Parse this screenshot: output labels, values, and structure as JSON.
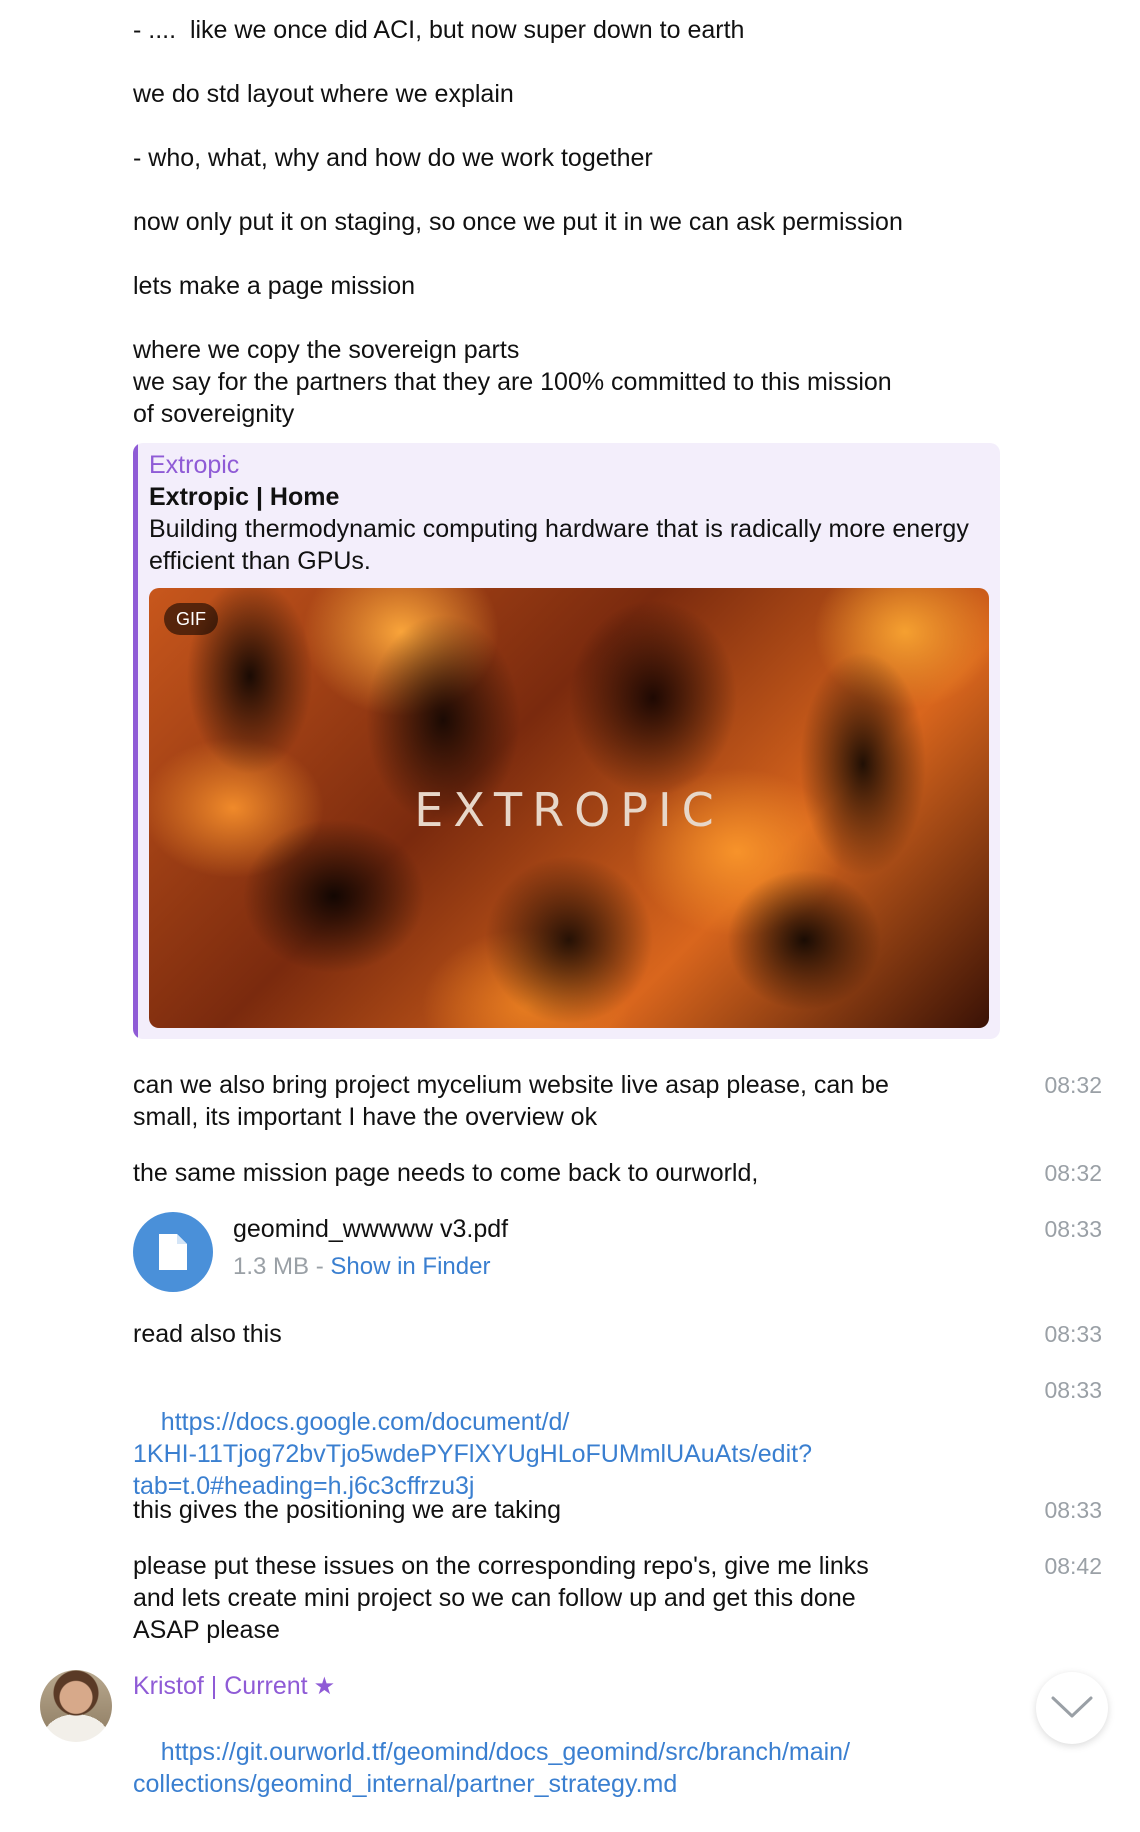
{
  "messages": [
    {
      "text": "- ....  like we once did ACI, but now super down to earth"
    },
    {
      "text": "we do std layout where we explain"
    },
    {
      "text": "- who, what, why and how do we work together"
    },
    {
      "text": "now only put it on staging, so once we put it in we can ask permission"
    },
    {
      "text": "lets make a page mission"
    },
    {
      "text": "where we copy the sovereign parts\nwe say for the partners that they are 100% committed to this mission\nof sovereignity"
    }
  ],
  "link_preview": {
    "site": "Extropic",
    "title": "Extropic | Home",
    "description": "Building thermodynamic computing hardware that is radically more energy efficient than GPUs.",
    "gif_badge": "GIF",
    "gif_logo": "EXTROPIC"
  },
  "timed_messages": [
    {
      "text": "can we also bring project mycelium website live asap please, can be\nsmall, its important I have the overview ok",
      "time": "08:32"
    },
    {
      "text": "the same mission page needs to come back to ourworld,",
      "time": "08:32"
    },
    {
      "text": "read also this",
      "time": "08:33"
    },
    {
      "text": "https://docs.google.com/document/d/\n1KHI-11Tjog72bvTjo5wdePYFlXYUgHLoFUMmlUAuAts/edit?\ntab=t.0#heading=h.j6c3cffrzu3j",
      "time": "08:33"
    },
    {
      "text": "this gives the positioning we are taking",
      "time": "08:33"
    },
    {
      "text": "please put these issues on the corresponding repo's, give me links\nand lets create mini project so we can follow up and get this done\nASAP please",
      "time": "08:42"
    }
  ],
  "file": {
    "name": "geomind_wwwww v3.pdf",
    "size": "1.3 MB",
    "separator": " - ",
    "action": "Show in Finder",
    "time": "08:33",
    "icon": "document-icon"
  },
  "last_message": {
    "sender": "Kristof | Current",
    "sender_badge": "star-icon",
    "link": "https://git.ourworld.tf/geomind/docs_geomind/src/branch/main/\ncollections/geomind_internal/partner_strategy.md"
  },
  "colors": {
    "accent": "#8f5bd6",
    "link": "#3a7fd0",
    "time": "#9aa0a6",
    "preview_bg": "#f3eefb"
  }
}
